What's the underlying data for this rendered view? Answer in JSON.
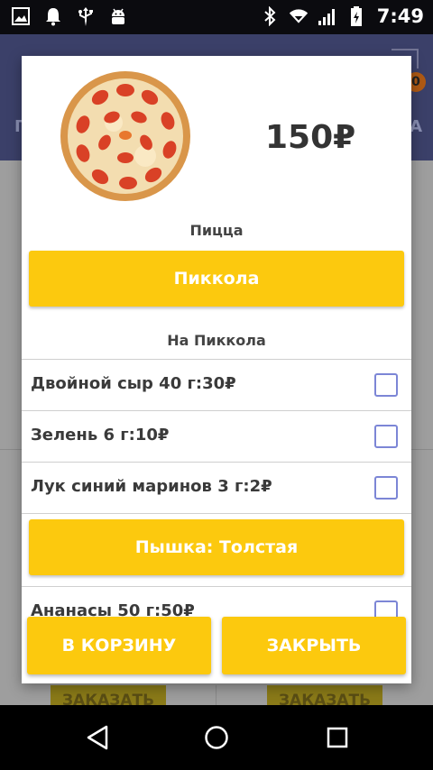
{
  "status_bar": {
    "time": "7:49",
    "left_icons": [
      "gallery-icon",
      "notification-bell-icon",
      "usb-icon",
      "android-icon"
    ],
    "right_icons": [
      "bluetooth-icon",
      "wifi-icon",
      "signal-icon",
      "battery-icon"
    ]
  },
  "background_app": {
    "header_color": "#3b4069",
    "tab_left": "П",
    "tab_right": "А",
    "cart_badge": "0",
    "order_buttons": [
      "ЗАКАЗАТЬ",
      "ЗАКАЗАТЬ"
    ]
  },
  "dialog": {
    "price": "150₽",
    "category_label": "Пицца",
    "product_button": "Пиккола",
    "toppings_label": "На Пиккола",
    "toppings": [
      {
        "label": "Двойной сыр 40 г:30₽",
        "checked": false
      },
      {
        "label": "Зелень 6 г:10₽",
        "checked": false
      },
      {
        "label": "Лук синий маринов 3 г:2₽",
        "checked": false
      }
    ],
    "crust_button": "Пышка: Толстая",
    "extra_topping": {
      "label": "Ананасы 50 г:50₽",
      "checked": false
    },
    "add_to_cart": "В КОРЗИНУ",
    "close": "ЗАКРЫТЬ",
    "accent_color": "#fcc90e"
  },
  "nav_bar": {
    "icons": [
      "back-icon",
      "home-icon",
      "recents-icon"
    ]
  }
}
